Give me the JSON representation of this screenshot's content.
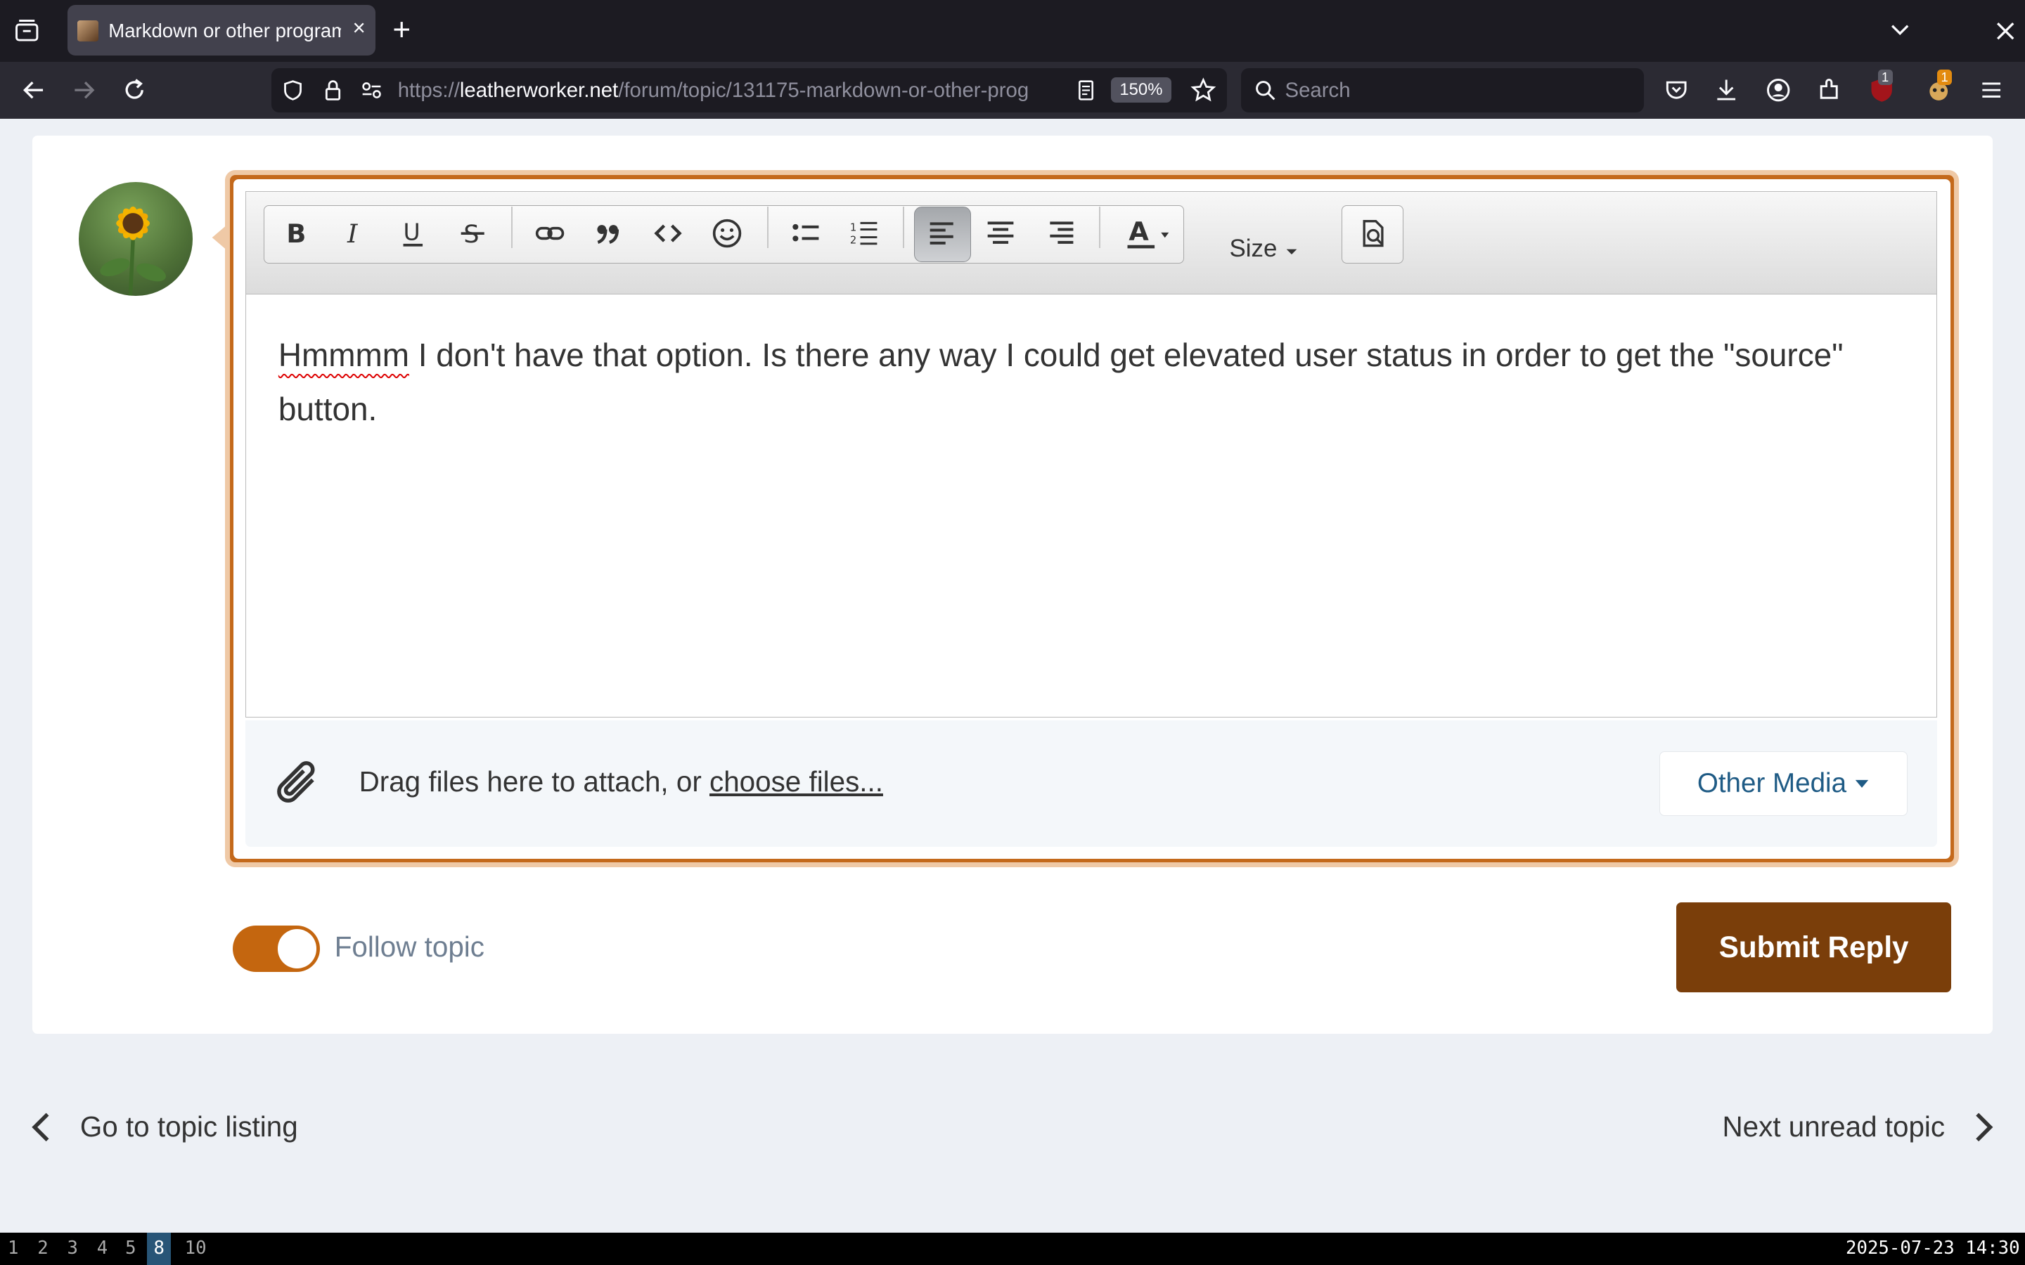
{
  "browser": {
    "tab_title": "Markdown or other programs...",
    "tab_close": "×",
    "new_tab": "+",
    "url_scheme": "https://",
    "url_host": "leatherworker.net",
    "url_path": "/forum/topic/131175-markdown-or-other-prog",
    "zoom": "150%",
    "search_placeholder": "Search",
    "ext_badge_1": "1",
    "ext_badge_2": "1"
  },
  "editor": {
    "toolbar": {
      "buttons": [
        "bold",
        "italic",
        "underline",
        "strikethrough",
        "link",
        "quote",
        "code",
        "emoji",
        "bulleted-list",
        "numbered-list",
        "align-left",
        "align-center",
        "align-right",
        "text-color"
      ],
      "active_button": "align-left",
      "size_label": "Size"
    },
    "content_misspelled": "Hmmmm",
    "content_rest": " I don't have that option. Is there any way I could get elevated user status in order to get the \"source\" button.",
    "attach_prefix": "Drag files here to attach, or ",
    "attach_link": "choose files...",
    "other_media": "Other Media"
  },
  "reply": {
    "follow_label": "Follow topic",
    "follow_on": true,
    "submit_label": "Submit Reply"
  },
  "topic_nav": {
    "prev": "Go to topic listing",
    "next": "Next unread topic"
  },
  "statusbar": {
    "workspaces": [
      "1",
      "2",
      "3",
      "4",
      "5",
      "8",
      "10"
    ],
    "active_workspace": "8",
    "datetime": "2025-07-23 14:30"
  },
  "colors": {
    "accent": "#c4660f",
    "submit_bg": "#7a3e0a",
    "link_blue": "#1f5b85"
  }
}
